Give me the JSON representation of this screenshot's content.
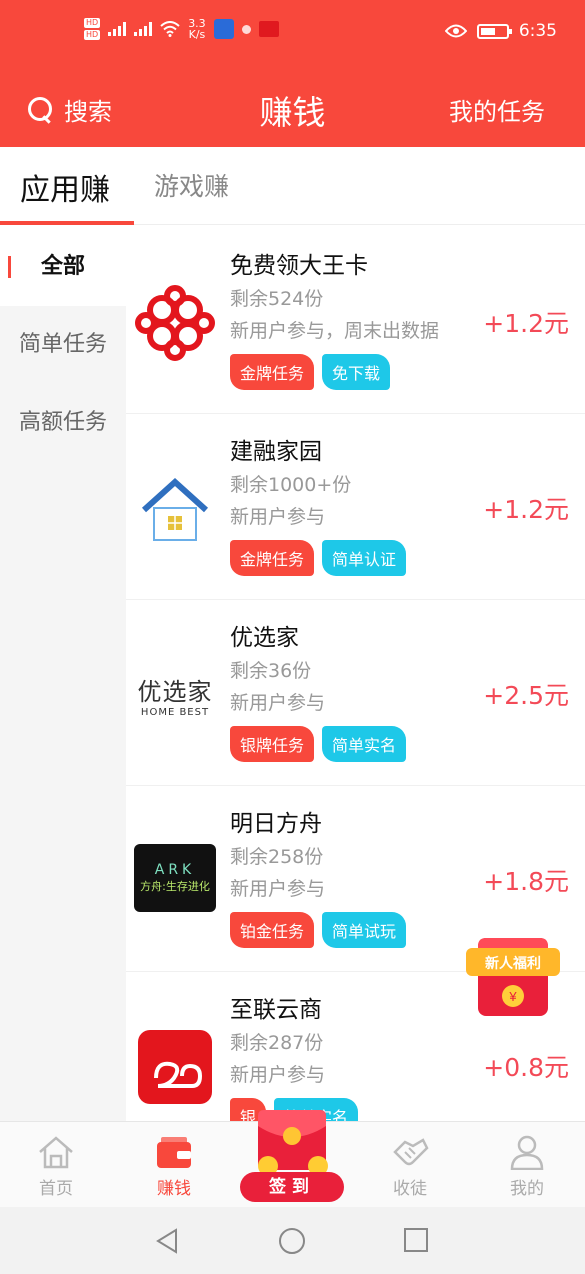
{
  "status_bar": {
    "speed_value": "3.3",
    "speed_unit": "K/s",
    "time": "6:35"
  },
  "header": {
    "search_label": "搜索",
    "title": "赚钱",
    "my_tasks_label": "我的任务"
  },
  "tabs": [
    {
      "label": "应用赚",
      "active": true
    },
    {
      "label": "游戏赚",
      "active": false
    }
  ],
  "sidebar": {
    "items": [
      {
        "label": "全部",
        "active": true
      },
      {
        "label": "简单任务",
        "active": false
      },
      {
        "label": "高额任务",
        "active": false
      }
    ]
  },
  "tasks": [
    {
      "name": "免费领大王卡",
      "remaining": "剩余524份",
      "desc": "新用户参与，周末出数据",
      "tags": [
        {
          "label": "金牌任务",
          "color": "red"
        },
        {
          "label": "免下载",
          "color": "cyan"
        }
      ],
      "reward": "+1.2元",
      "icon": "china-unicom-logo"
    },
    {
      "name": "建融家园",
      "remaining": "剩余1000+份",
      "desc": "新用户参与",
      "tags": [
        {
          "label": "金牌任务",
          "color": "red"
        },
        {
          "label": "简单认证",
          "color": "cyan"
        }
      ],
      "reward": "+1.2元",
      "icon": "house-logo"
    },
    {
      "name": "优选家",
      "remaining": "剩余36份",
      "desc": "新用户参与",
      "tags": [
        {
          "label": "银牌任务",
          "color": "red"
        },
        {
          "label": "简单实名",
          "color": "cyan"
        }
      ],
      "reward": "+2.5元",
      "icon": "youxuanjia-logo",
      "logo_text": "优选家",
      "logo_subtext": "HOME BEST"
    },
    {
      "name": "明日方舟",
      "remaining": "剩余258份",
      "desc": "新用户参与",
      "tags": [
        {
          "label": "铂金任务",
          "color": "red"
        },
        {
          "label": "简单试玩",
          "color": "cyan"
        }
      ],
      "reward": "+1.8元",
      "icon": "ark-logo",
      "logo_text": "ARK",
      "logo_subtext": "方舟:生存进化"
    },
    {
      "name": "至联云商",
      "remaining": "剩余287份",
      "desc": "新用户参与",
      "tags": [
        {
          "label": "银",
          "color": "red"
        },
        {
          "label": "简单实名",
          "color": "cyan"
        }
      ],
      "reward": "+0.8元",
      "icon": "zhilian-logo"
    }
  ],
  "float_gift": {
    "label": "新人福利"
  },
  "bottom_nav": [
    {
      "label": "首页",
      "icon": "home-icon",
      "active": false
    },
    {
      "label": "赚钱",
      "icon": "wallet-icon",
      "active": true
    },
    {
      "label": "签到",
      "icon": "checkin-icon",
      "active": false
    },
    {
      "label": "收徒",
      "icon": "handshake-icon",
      "active": false
    },
    {
      "label": "我的",
      "icon": "user-icon",
      "active": false
    }
  ],
  "colors": {
    "primary": "#f8483c",
    "cyan_tag": "#1ec8e8",
    "price": "#f34a57"
  }
}
